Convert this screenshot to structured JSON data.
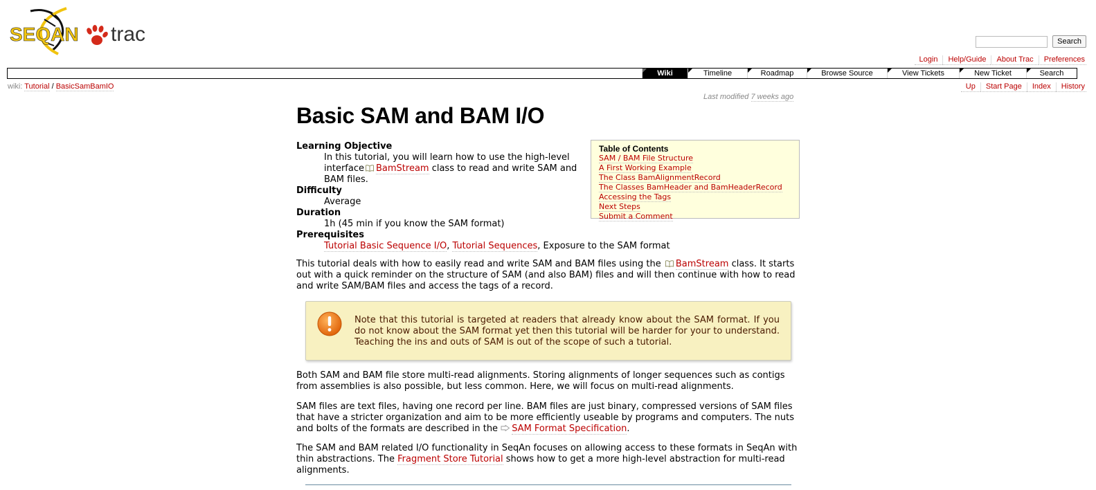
{
  "header": {
    "logo_text": {
      "seq": "SEQAN",
      "trac": "trac"
    },
    "search": {
      "value": "",
      "button": "Search"
    },
    "metanav": [
      "Login",
      "Help/Guide",
      "About Trac",
      "Preferences"
    ],
    "mainnav": [
      {
        "label": "Wiki",
        "active": true
      },
      {
        "label": "Timeline",
        "active": false
      },
      {
        "label": "Roadmap",
        "active": false
      },
      {
        "label": "Browse Source",
        "active": false
      },
      {
        "label": "View Tickets",
        "active": false
      },
      {
        "label": "New Ticket",
        "active": false
      },
      {
        "label": "Search",
        "active": false
      }
    ],
    "breadcrumb": {
      "label": "wiki:",
      "items": [
        "Tutorial",
        "BasicSamBamIO"
      ],
      "sep": "/"
    },
    "ctxtnav": [
      "Up",
      "Start Page",
      "Index",
      "History"
    ]
  },
  "page": {
    "last_modified_prefix": "Last modified",
    "last_modified_ago": "7 weeks ago",
    "title": "Basic SAM and BAM I/O",
    "toc": {
      "title": "Table of Contents",
      "items": [
        "SAM / BAM File Structure",
        "A First Working Example",
        "The Class  BamAlignmentRecord",
        "The Classes  BamHeader and  BamHeaderRecord",
        "Accessing the Tags",
        "Next Steps",
        "Submit a Comment"
      ]
    },
    "meta": {
      "objective_label": "Learning Objective",
      "objective_1": "In this tutorial, you will learn how to use the high-level interface",
      "objective_link": "BamStream",
      "objective_2": " class to read and write SAM and BAM files.",
      "difficulty_label": "Difficulty",
      "difficulty": "Average",
      "duration_label": "Duration",
      "duration": "1h (45 min if you know the SAM format)",
      "prereq_label": "Prerequisites",
      "prereq_link1": "Tutorial Basic Sequence I/O",
      "prereq_sep": ", ",
      "prereq_link2": "Tutorial Sequences",
      "prereq_tail": ", Exposure to the SAM format"
    },
    "intro": {
      "t1": "This tutorial deals with how to easily read and write SAM and BAM files using the",
      "link": "BamStream",
      "t2": " class. It starts out with a quick reminder on the structure of SAM (and also BAM) files and will then continue with how to read and write SAM/BAM files and access the tags of a record."
    },
    "note": "Note that this tutorial is targeted at readers that already know about the SAM format. If you do not know about the SAM format yet then this tutorial will be harder for your to understand. Teaching the ins and outs of SAM is out of the scope of such a tutorial.",
    "p_alignments": "Both SAM and BAM file store multi-read alignments. Storing alignments of longer sequences such as contigs from assemblies is also possible, but less common. Here, we will focus on multi-read alignments.",
    "p_samfiles": {
      "t1": "SAM files are text files, having one record per line. BAM files are just binary, compressed versions of SAM files that have a stricter organization and aim to be more efficiently useable by programs and computers. The nuts and bolts of the formats are described in the ",
      "link": "SAM Format Specification",
      "t2": "."
    },
    "p_seqan": {
      "t1": "The SAM and BAM related I/O functionality in SeqAn focuses on allowing access to these formats in SeqAn with thin abstractions. The ",
      "link": "Fragment Store Tutorial",
      "t2": " shows how to get a more high-level abstraction for multi-read alignments."
    }
  },
  "icons": [
    "trac-paw-icon",
    "dna-helix-icon",
    "book-icon",
    "external-link-icon",
    "warning-icon"
  ],
  "colors": {
    "link": "#bb0000",
    "toc_bg": "#ffffdd",
    "note_bg": "#f8f1c1",
    "logo_yellow": "#f1c40f",
    "paw_red": "#d42a1a"
  }
}
